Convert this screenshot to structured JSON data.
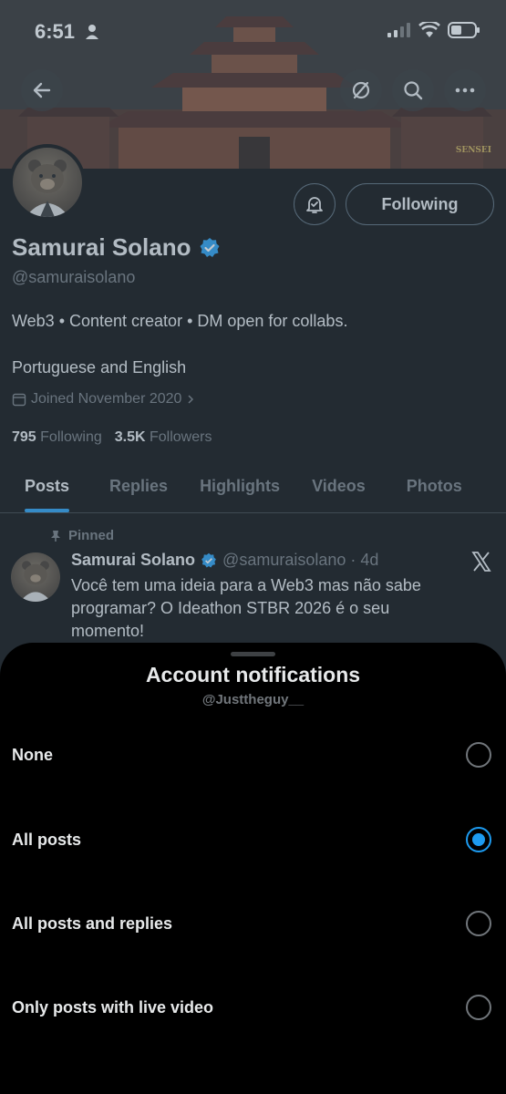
{
  "status_bar": {
    "time": "6:51"
  },
  "banner": {
    "watermark": "SENSEI"
  },
  "header": {
    "back_icon": "back-arrow-icon",
    "grok_icon": "grok-icon",
    "search_icon": "search-icon",
    "more_icon": "more-icon"
  },
  "profile": {
    "name": "Samurai Solano",
    "handle": "@samuraisolano",
    "bio": "Web3 • Content creator • DM open for collabs.",
    "languages": "Portuguese and English",
    "joined": "Joined November 2020",
    "following_count": "795",
    "following_label": "Following",
    "followers_count": "3.5K",
    "followers_label": "Followers",
    "follow_button": "Following"
  },
  "tabs": [
    {
      "label": "Posts",
      "active": true
    },
    {
      "label": "Replies"
    },
    {
      "label": "Highlights"
    },
    {
      "label": "Videos"
    },
    {
      "label": "Photos"
    }
  ],
  "pinned_post": {
    "pinned_label": "Pinned",
    "author": "Samurai Solano",
    "handle_time": "@samuraisolano · 4d",
    "text": "Você tem uma ideia para a Web3 mas não sabe programar? O Ideathon STBR 2026 é o seu momento!"
  },
  "sheet": {
    "title": "Account notifications",
    "subtitle": "@Justtheguy__",
    "options": [
      {
        "label": "None",
        "selected": false
      },
      {
        "label": "All posts",
        "selected": true
      },
      {
        "label": "All posts and replies",
        "selected": false
      },
      {
        "label": "Only posts with live video",
        "selected": false
      }
    ]
  },
  "colors": {
    "accent": "#1d9bf0",
    "muted": "#71767b",
    "text": "#e7e9ea"
  }
}
